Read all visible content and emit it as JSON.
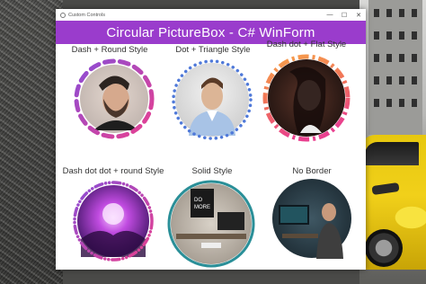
{
  "window": {
    "title": "Custom Controls",
    "header": "Circular PictureBox - C# WinForm",
    "minimize_glyph": "—",
    "maximize_glyph": "☐",
    "close_glyph": "✕"
  },
  "pictures": [
    {
      "label": "Dash + Round Style"
    },
    {
      "label": "Dot + Triangle Style"
    },
    {
      "label": "Dash dot + Flat Style"
    },
    {
      "label": "Dash dot dot + round Style"
    },
    {
      "label": "Solid Style"
    },
    {
      "label": "No Border"
    }
  ],
  "colors": {
    "header_bg": "#9a3ccc",
    "gradient_purple": "#8a4dd6",
    "gradient_pink": "#e9408f",
    "gradient_orange": "#f7a24a",
    "dot_blue": "#4f79d9",
    "solid_teal": "#2a8f98"
  }
}
